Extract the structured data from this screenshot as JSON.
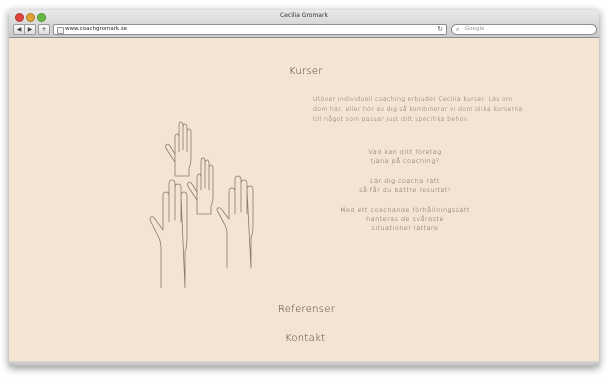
{
  "window": {
    "title": "Cecilia Gromark"
  },
  "toolbar": {
    "back_icon": "back-arrow-icon",
    "forward_icon": "forward-arrow-icon",
    "add_icon": "plus-icon",
    "url": "www.coachgromark.se",
    "reload_icon": "reload-icon",
    "search_placeholder": "Google"
  },
  "page": {
    "nav": {
      "kurser": "Kurser",
      "referenser": "Referenser",
      "kontakt": "Kontakt"
    },
    "intro": "Utöver individuell coaching erbjuder Cecilia kurser. Läs om dom här, eller hör av dig så kombinerar vi dom olika kurserna till något som passar just ditt specifika behov.",
    "questions": [
      {
        "line1": "Vad kan ditt företag",
        "line2": "tjäna på coaching?"
      },
      {
        "line1": "Lär dig coacha rätt",
        "line2": "så får du bättre resultat!"
      },
      {
        "line1": "Med ett coachande förhållningssätt",
        "line2": "hanteras de svåraste",
        "line3": "situationer lättare"
      }
    ]
  },
  "colors": {
    "background": "#f3e4d4",
    "text": "#4a4036",
    "hand_stroke": "#8a7a68"
  }
}
